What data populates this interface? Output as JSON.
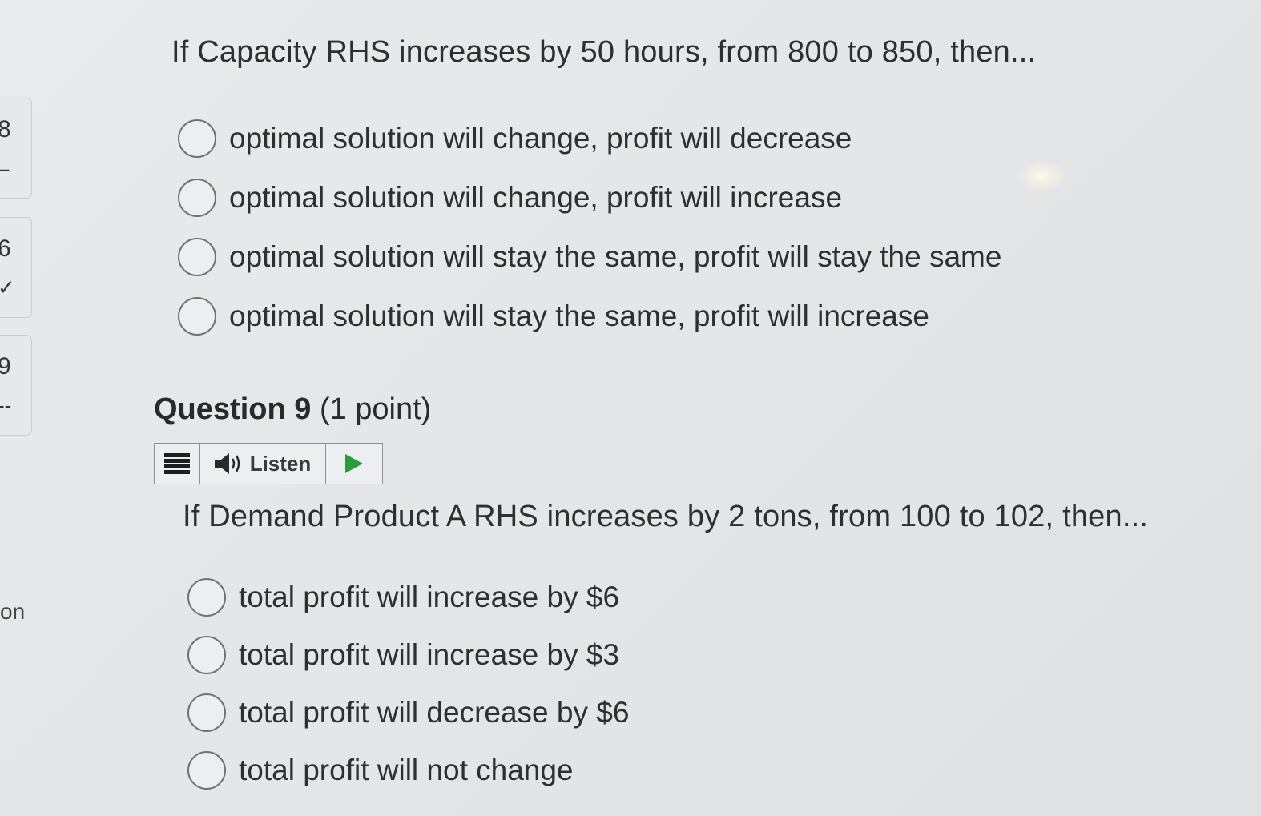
{
  "nav": {
    "cards": [
      {
        "num": "8",
        "mark": "–"
      },
      {
        "num": "6",
        "mark": "✓"
      },
      {
        "num": "9",
        "mark": "--"
      }
    ],
    "tail": "on"
  },
  "question8": {
    "prompt": "If Capacity RHS increases by 50 hours, from 800 to 850, then...",
    "options": [
      "optimal solution will change, profit will decrease",
      "optimal solution will change, profit will increase",
      "optimal solution will stay the same, profit will stay the same",
      "optimal solution will stay the same, profit will increase"
    ]
  },
  "question9": {
    "title": "Question 9",
    "points": "(1 point)",
    "listen": {
      "label": "Listen",
      "menu_icon": "hamburger-menu-icon",
      "speaker_icon": "speaker-icon",
      "play_icon": "play-icon",
      "play_color": "#2e9a3e"
    },
    "prompt": "If Demand Product A RHS increases by 2 tons, from 100 to 102, then...",
    "options": [
      "total profit will increase by $6",
      "total profit will increase by $3",
      "total profit will decrease by $6",
      "total profit will not change"
    ]
  }
}
